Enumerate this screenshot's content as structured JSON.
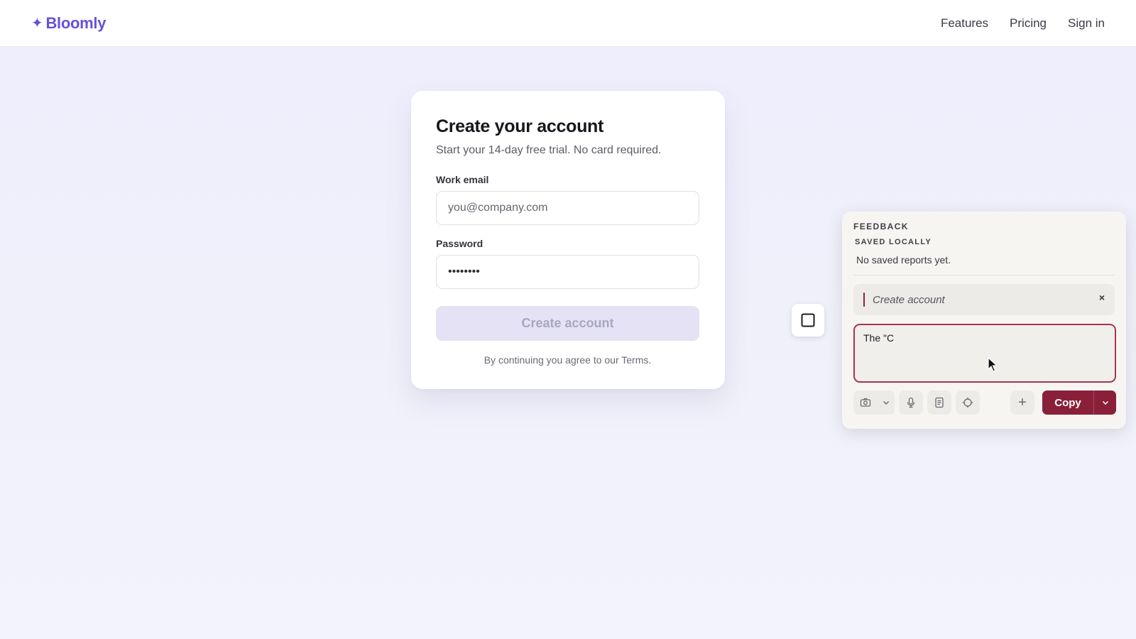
{
  "header": {
    "logo_mark": "✦",
    "brand": "Bloomly",
    "nav": [
      {
        "label": "Features"
      },
      {
        "label": "Pricing"
      },
      {
        "label": "Sign in"
      }
    ]
  },
  "signup": {
    "title": "Create your account",
    "subtitle": "Start your 14-day free trial. No card required.",
    "email_label": "Work email",
    "email_placeholder": "you@company.com",
    "password_label": "Password",
    "password_value": "••••••••",
    "submit_label": "Create account",
    "terms_text": "By continuing you agree to our Terms."
  },
  "feedback": {
    "title": "FEEDBACK",
    "saved_heading": "SAVED LOCALLY",
    "empty_text": "No saved reports yet.",
    "target_label": "Create account",
    "close_glyph": "×",
    "draft_text": "The \"C",
    "copy_label": "Copy",
    "plus_glyph": "+"
  },
  "colors": {
    "brand": "#6a4fd8",
    "accent": "#8a1f3a",
    "focus_border": "#a8344d",
    "disabled_button": "#e4e2f4"
  },
  "icons": {
    "select_box": "square-icon",
    "camera": "camera-icon",
    "caret": "chevron-down-icon",
    "mic": "microphone-icon",
    "note": "document-icon",
    "target": "crosshair-icon",
    "plus": "plus-icon"
  }
}
